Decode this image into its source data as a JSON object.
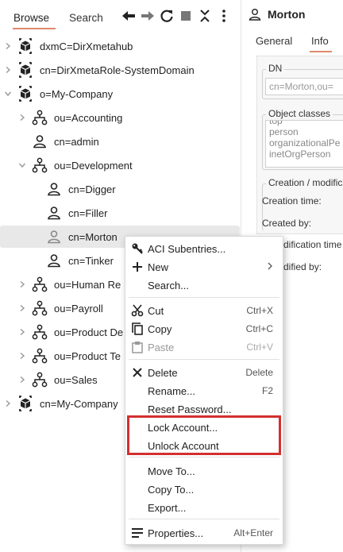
{
  "browser": {
    "tabs": [
      "Browse",
      "Search"
    ],
    "toolbar": [
      "back-icon",
      "forward-icon",
      "refresh-icon",
      "stop-icon",
      "collapse-icon",
      "more-icon"
    ],
    "tree": [
      {
        "label": "dxmC=DirXmetahub",
        "icon": "cube-icon",
        "expand": "collapsed"
      },
      {
        "label": "cn=DirXmetaRole-SystemDomain",
        "icon": "cube-icon",
        "expand": "collapsed"
      },
      {
        "label": "o=My-Company",
        "icon": "cube-icon",
        "expand": "expanded"
      },
      {
        "label": "ou=Accounting",
        "icon": "org-icon",
        "expand": "collapsed"
      },
      {
        "label": "cn=admin",
        "icon": "person-icon",
        "expand": "none"
      },
      {
        "label": "ou=Development",
        "icon": "org-icon",
        "expand": "expanded"
      },
      {
        "label": "cn=Digger",
        "icon": "person-icon",
        "expand": "none"
      },
      {
        "label": "cn=Filler",
        "icon": "person-icon",
        "expand": "none"
      },
      {
        "label": "cn=Morton",
        "icon": "person-icon",
        "expand": "none",
        "selected": true
      },
      {
        "label": "cn=Tinker",
        "icon": "person-icon",
        "expand": "none"
      },
      {
        "label": "ou=Human Re",
        "icon": "org-icon",
        "expand": "collapsed"
      },
      {
        "label": "ou=Payroll",
        "icon": "org-icon",
        "expand": "collapsed"
      },
      {
        "label": "ou=Product De",
        "icon": "org-icon",
        "expand": "collapsed"
      },
      {
        "label": "ou=Product Te",
        "icon": "org-icon",
        "expand": "collapsed"
      },
      {
        "label": "ou=Sales",
        "icon": "org-icon",
        "expand": "collapsed"
      },
      {
        "label": "cn=My-Company",
        "icon": "cube-icon",
        "expand": "collapsed"
      }
    ]
  },
  "details": {
    "title": "Morton",
    "tabs": [
      "General",
      "Info"
    ],
    "dn_label": "DN",
    "dn_value": "cn=Morton,ou=",
    "object_classes_label": "Object classes",
    "object_classes": [
      "top",
      "person",
      "organizationalPe",
      "inetOrgPerson"
    ],
    "creation_label": "Creation / modific",
    "creation_time": "Creation time:",
    "created_by": "Created by:",
    "modification_time": "dification time",
    "modified_by": "dified by:"
  },
  "context_menu": {
    "items": [
      {
        "label": "ACI Subentries...",
        "icon": "key-icon"
      },
      {
        "label": "New",
        "icon": "plus-icon",
        "submenu": true
      },
      {
        "label": "Search..."
      },
      {
        "label": "Cut",
        "icon": "scissors-icon",
        "shortcut": "Ctrl+X"
      },
      {
        "label": "Copy",
        "icon": "copy-icon",
        "shortcut": "Ctrl+C"
      },
      {
        "label": "Paste",
        "icon": "paste-icon",
        "shortcut": "Ctrl+V",
        "disabled": true
      },
      {
        "label": "Delete",
        "icon": "x-icon",
        "shortcut": "Delete"
      },
      {
        "label": "Rename...",
        "shortcut": "F2"
      },
      {
        "label": "Reset Password..."
      },
      {
        "label": "Lock Account..."
      },
      {
        "label": "Unlock Account"
      },
      {
        "label": "Move To..."
      },
      {
        "label": "Copy To..."
      },
      {
        "label": "Export..."
      },
      {
        "label": "Properties...",
        "icon": "properties-icon",
        "shortcut": "Alt+Enter"
      }
    ],
    "highlight_color": "#d32f2f"
  },
  "colors": {
    "accent": "#e08a6c",
    "selection": "#e8e8e8"
  }
}
